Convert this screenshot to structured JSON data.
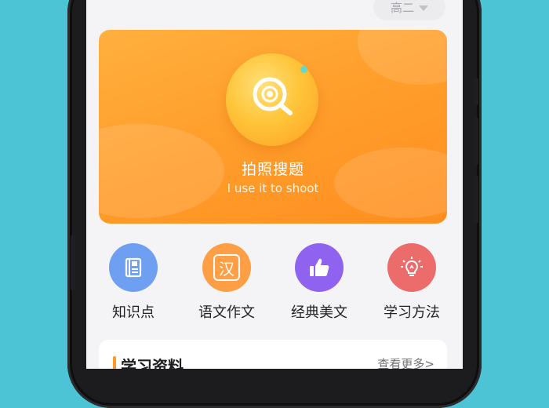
{
  "header": {
    "grade_selected": "高二"
  },
  "banner": {
    "title": "拍照搜题",
    "subtitle": "I use it to shoot"
  },
  "features": [
    {
      "label": "知识点",
      "icon": "book-icon",
      "color": "#6f9ff0"
    },
    {
      "label": "语文作文",
      "icon": "han-character-icon",
      "color": "#ff9f45"
    },
    {
      "label": "经典美文",
      "icon": "thumbs-up-icon",
      "color": "#8f63f0"
    },
    {
      "label": "学习方法",
      "icon": "lightbulb-icon",
      "color": "#ec6b6b"
    }
  ],
  "han_glyph": "汉",
  "section": {
    "title": "学习资料",
    "more_link": "查看更多>"
  },
  "colors": {
    "background": "#4dc3d6",
    "banner_orange": "#ff9f2c",
    "accent_bar": "#ff9a2a"
  }
}
